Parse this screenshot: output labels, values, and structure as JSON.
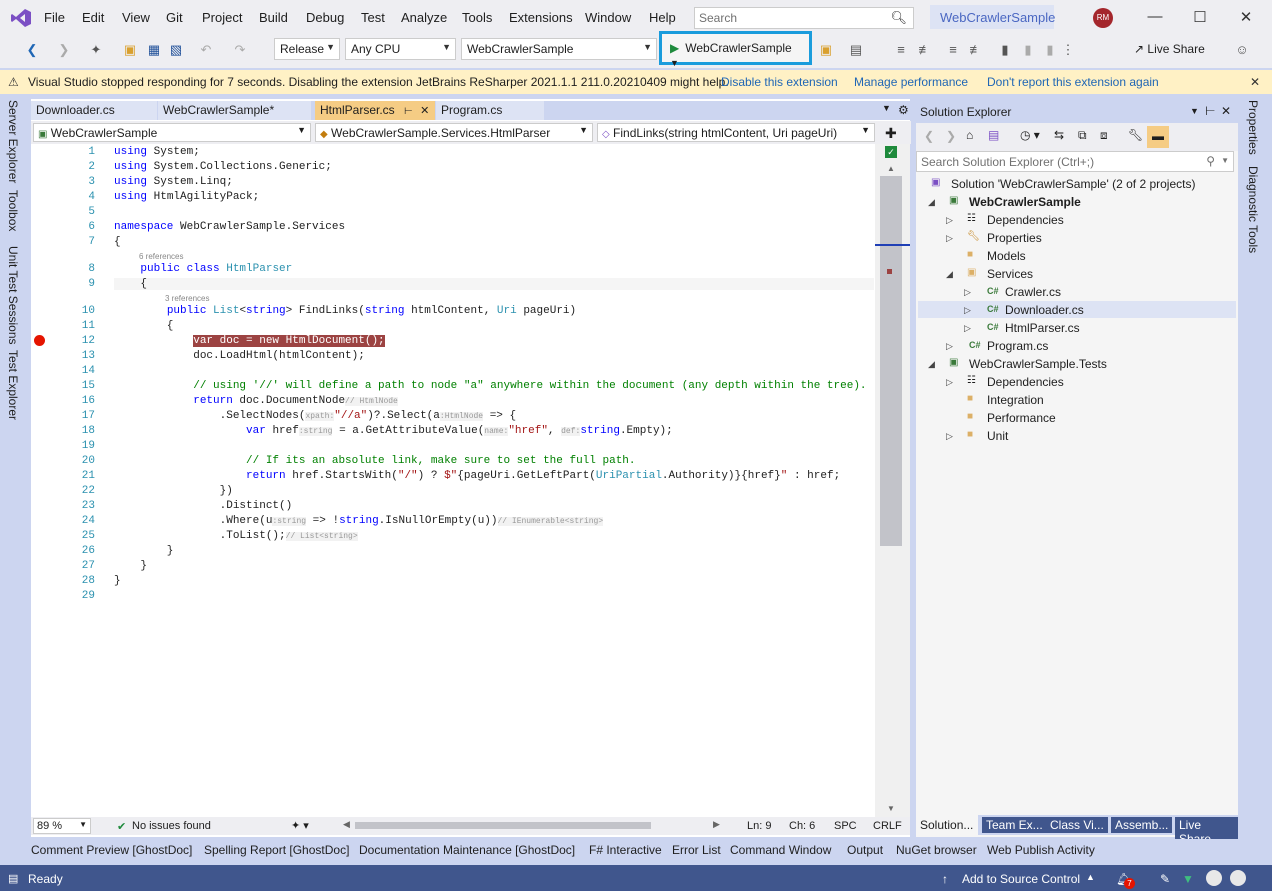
{
  "menu": {
    "items": [
      "File",
      "Edit",
      "View",
      "Git",
      "Project",
      "Build",
      "Debug",
      "Test",
      "Analyze",
      "Tools",
      "Extensions",
      "Window",
      "Help"
    ],
    "search_placeholder": "Search",
    "window_title": "WebCrawlerSample",
    "avatar": "RM"
  },
  "toolbar": {
    "config": "Release",
    "platform": "Any CPU",
    "project": "WebCrawlerSample",
    "run_label": "WebCrawlerSample",
    "live_share": "Live Share"
  },
  "infobar": {
    "message": "Visual Studio stopped responding for 7 seconds. Disabling the extension JetBrains ReSharper 2021.1.1 211.0.20210409 might help.",
    "disable": "Disable this extension",
    "manage": "Manage performance",
    "dont_report": "Don't report this extension again"
  },
  "left_tabs": [
    "Server Explorer",
    "Toolbox",
    "Unit Test Sessions",
    "Test Explorer"
  ],
  "right_tabs": [
    "Properties",
    "Diagnostic Tools"
  ],
  "doc_tabs": [
    "Downloader.cs",
    "WebCrawlerSample*",
    "HtmlParser.cs",
    "Program.cs"
  ],
  "nav": {
    "project": "WebCrawlerSample",
    "class": "WebCrawlerSample.Services.HtmlParser",
    "member": "FindLinks(string htmlContent, Uri pageUri)"
  },
  "code": {
    "refs": {
      "class": "6 references",
      "method": "3 references"
    },
    "lines": [
      "1",
      "2",
      "3",
      "4",
      "5",
      "6",
      "7",
      "8",
      "9",
      "10",
      "11",
      "12",
      "13",
      "14",
      "15",
      "16",
      "17",
      "18",
      "19",
      "20",
      "21",
      "22",
      "23",
      "24",
      "25",
      "26",
      "27",
      "28",
      "29"
    ],
    "hints": {
      "xpath": "xpath:",
      "htmlnode_arg": ":HtmlNode",
      "htmlnode": "// HtmlNode",
      "string1": ":string",
      "name": "name:",
      "def": "def:",
      "string2": ":string",
      "ienum": "// IEnumerable<string>",
      "list": "// List<string>"
    }
  },
  "editor_status": {
    "zoom": "89 %",
    "issues": "No issues found",
    "ln": "Ln: 9",
    "ch": "Ch: 6",
    "spc": "SPC",
    "crlf": "CRLF"
  },
  "solution_explorer": {
    "title": "Solution Explorer",
    "search_placeholder": "Search Solution Explorer (Ctrl+;)",
    "items": [
      "Solution 'WebCrawlerSample' (2 of 2 projects)",
      "WebCrawlerSample",
      "Dependencies",
      "Properties",
      "Models",
      "Services",
      "Crawler.cs",
      "Downloader.cs",
      "HtmlParser.cs",
      "Program.cs",
      "WebCrawlerSample.Tests",
      "Dependencies",
      "Integration",
      "Performance",
      "Unit"
    ],
    "tabs": [
      "Solution...",
      "Team Ex...",
      "Class Vi...",
      "Assemb...",
      "Live Share"
    ]
  },
  "tool_windows": [
    "Comment Preview [GhostDoc]",
    "Spelling Report [GhostDoc]",
    "Documentation Maintenance [GhostDoc]",
    "F# Interactive",
    "Error List",
    "Command Window",
    "Output",
    "NuGet browser",
    "Web Publish Activity"
  ],
  "statusbar": {
    "ready": "Ready",
    "source_control": "Add to Source Control",
    "notifications": "7"
  },
  "colors": {
    "accent": "#1a9cdc",
    "statusbar": "#40568d",
    "breakpoint": "#e51400"
  }
}
